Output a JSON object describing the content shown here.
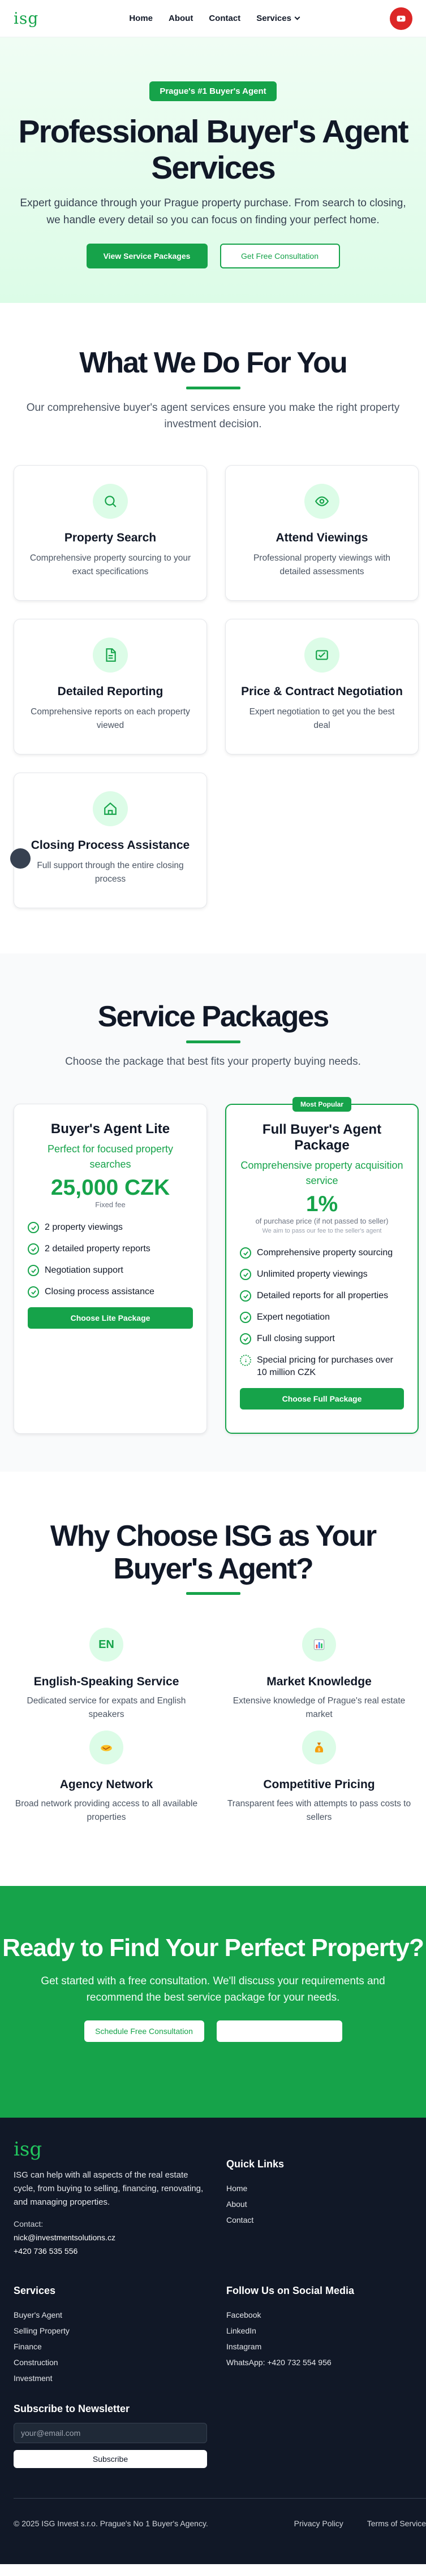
{
  "header": {
    "logo": "isg",
    "nav": [
      "Home",
      "About",
      "Contact",
      "Services"
    ],
    "youtube_icon": "youtube-icon"
  },
  "hero": {
    "badge": "Prague's #1 Buyer's Agent",
    "title": "Professional Buyer's Agent Services",
    "subtitle": "Expert guidance through your Prague property purchase. From search to closing, we handle every detail so you can focus on finding your perfect home.",
    "primary_btn": "View Service Packages",
    "secondary_btn": "Get Free Consultation"
  },
  "what": {
    "title": "What We Do For You",
    "subtitle": "Our comprehensive buyer's agent services ensure you make the right property investment decision.",
    "cards": [
      {
        "icon": "search-icon",
        "title": "Property Search",
        "text": "Comprehensive property sourcing to your exact specifications"
      },
      {
        "icon": "eye-icon",
        "title": "Attend Viewings",
        "text": "Professional property viewings with detailed assessments"
      },
      {
        "icon": "document-icon",
        "title": "Detailed Reporting",
        "text": "Comprehensive reports on each property viewed"
      },
      {
        "icon": "handshake-icon",
        "title": "Price & Contract Negotiation",
        "text": "Expert negotiation to get you the best deal"
      },
      {
        "icon": "home-icon",
        "title": "Closing Process Assistance",
        "text": "Full support through the entire closing process"
      }
    ]
  },
  "packages": {
    "title": "Service Packages",
    "subtitle": "Choose the package that best fits your property buying needs.",
    "lite": {
      "title": "Buyer's Agent Lite",
      "sub": "Perfect for focused property searches",
      "price": "25,000 CZK",
      "fee": "Fixed fee",
      "features": [
        "2 property viewings",
        "2 detailed property reports",
        "Negotiation support",
        "Closing process assistance"
      ],
      "btn": "Choose Lite Package"
    },
    "full": {
      "badge": "Most Popular",
      "title": "Full Buyer's Agent Package",
      "sub": "Comprehensive property acquisition service",
      "price": "1%",
      "fee": "of purchase price (if not passed to seller)",
      "note": "We aim to pass our fee to the seller's agent",
      "features": [
        "Comprehensive property sourcing",
        "Unlimited property viewings",
        "Detailed reports for all properties",
        "Expert negotiation",
        "Full closing support"
      ],
      "special": "Special pricing for purchases over 10 million CZK",
      "btn": "Choose Full Package"
    }
  },
  "why": {
    "title": "Why Choose ISG as Your Buyer's Agent?",
    "items": [
      {
        "icon": "EN",
        "title": "English-Speaking Service",
        "text": "Dedicated service for expats and English speakers"
      },
      {
        "icon": "chart-icon",
        "title": "Market Knowledge",
        "text": "Extensive knowledge of Prague's real estate market"
      },
      {
        "icon": "handshake-emoji-icon",
        "title": "Agency Network",
        "text": "Broad network providing access to all available properties"
      },
      {
        "icon": "money-bag-icon",
        "title": "Competitive Pricing",
        "text": "Transparent fees with attempts to pass costs to sellers"
      }
    ]
  },
  "cta": {
    "title": "Ready to Find Your Perfect Property?",
    "subtitle": "Get started with a free consultation. We'll discuss your requirements and recommend the best service package for your needs.",
    "btn": "Schedule Free Consultation"
  },
  "footer": {
    "logo": "isg",
    "desc": "ISG can help with all aspects of the real estate cycle, from buying to selling, financing, renovating, and managing properties.",
    "contact_label": "Contact:",
    "email": "nick@investmentsolutions.cz",
    "phone": "+420 736 535 556",
    "quick_title": "Quick Links",
    "quick": [
      "Home",
      "About",
      "Contact"
    ],
    "services_title": "Services",
    "services": [
      "Buyer's Agent",
      "Selling Property",
      "Finance",
      "Construction",
      "Investment"
    ],
    "social_title": "Follow Us on Social Media",
    "social": [
      "Facebook",
      "LinkedIn",
      "Instagram",
      "WhatsApp: +420 732 554 956"
    ],
    "news_title": "Subscribe to Newsletter",
    "news_placeholder": "your@email.com",
    "news_btn": "Subscribe",
    "copyright": "© 2025 ISG Invest s.r.o. Prague's No 1 Buyer's Agency.",
    "privacy": "Privacy Policy",
    "terms": "Terms of Service"
  }
}
